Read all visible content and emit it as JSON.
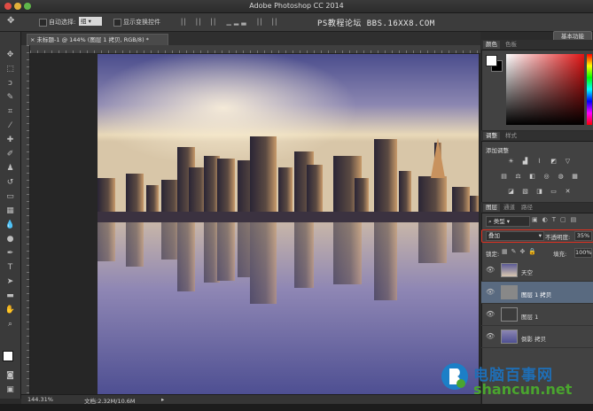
{
  "app": {
    "title": "Adobe Photoshop CC 2014",
    "watermark": "PS教程论坛 BBS.16XX8.COM"
  },
  "options_bar": {
    "auto_select_label": "自动选择:",
    "auto_select_value": "组",
    "show_transform_label": "显示变换控件",
    "workspace_button": "基本功能"
  },
  "document": {
    "tab_label": "未标题-1 @ 144% (图层 1 拷贝, RGB/8) *",
    "tab_close": "×"
  },
  "status": {
    "zoom": "144.31%",
    "doc_size": "文档:2.32M/10.6M"
  },
  "panels": {
    "color_tabs": [
      "颜色",
      "色板"
    ],
    "adjust_tabs": [
      "调整",
      "样式"
    ],
    "adjust_title": "添加调整",
    "layers_tabs": [
      "图层",
      "通道",
      "路径"
    ],
    "filter_kind": "类型",
    "blend_mode": "叠加",
    "opacity_label": "不透明度:",
    "opacity_value": "35%",
    "lock_label": "锁定:",
    "fill_label": "填充:",
    "fill_value": "100%"
  },
  "layers": [
    {
      "name": "天空",
      "selected": false
    },
    {
      "name": "图层 1 拷贝",
      "selected": true
    },
    {
      "name": "图层 1",
      "selected": false
    },
    {
      "name": "倒影 拷贝",
      "selected": false
    }
  ],
  "brand": {
    "name_cn": "电脑百事网",
    "domain": "shancun.net"
  },
  "colors": {
    "selected_layer": "#596a80",
    "highlight_border": "#e03020",
    "brand_blue": "#1c7fc7",
    "brand_green": "#4aa52e"
  }
}
